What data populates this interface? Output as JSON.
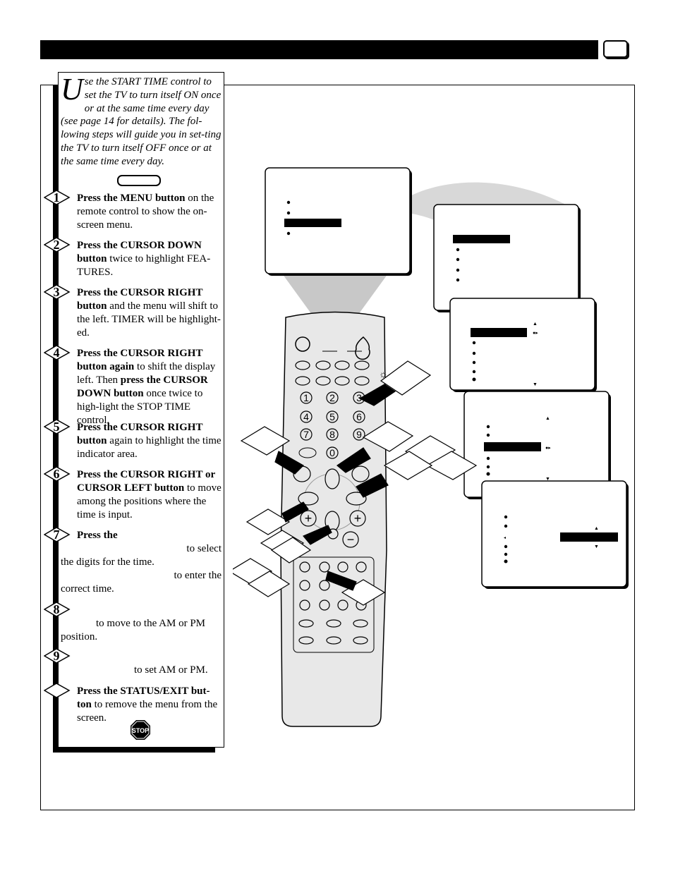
{
  "header": {
    "page_number": ""
  },
  "intro": {
    "dropcap": "U",
    "text": "se the START TIME control to set the TV to turn itself ON once or at the same time every day (see page 14  for details).  The fol-lowing steps will guide you in set-ting the TV to turn itself OFF once or at the same time every day."
  },
  "steps": [
    {
      "num": "1",
      "bold": "Press the MENU button",
      "text": " on the remote control to show the on-screen menu."
    },
    {
      "num": "2",
      "bold": "Press the CURSOR DOWN button",
      "text": " twice to highlight FEA-TURES."
    },
    {
      "num": "3",
      "bold": "Press the CURSOR RIGHT button",
      "text": " and the menu will shift to the left. TIMER will be highlight-ed."
    },
    {
      "num": "4",
      "bold": "Press the CURSOR RIGHT button again",
      "text": " to shift the display left. Then ",
      "bold2": "press the CURSOR DOWN button",
      "text2": " once twice to high-light the STOP TIME control."
    },
    {
      "num": "5",
      "bold": "Press the CURSOR RIGHT button",
      "text": " again to highlight the time indicator area."
    },
    {
      "num": "6",
      "bold": "Press the CURSOR RIGHT or CURSOR LEFT button",
      "text": " to move among the positions where the time is input."
    },
    {
      "num": "7",
      "bold": "Press the",
      "line2": "to select",
      "line3": "the digits for the time.",
      "line4": "to enter the",
      "line5": "correct time."
    },
    {
      "num": "8",
      "line2": "to move to the AM or PM",
      "line3": "position."
    },
    {
      "num": "9",
      "line2": "to set AM or PM."
    },
    {
      "num": "",
      "bold": "Press the STATUS/EXIT but-ton",
      "text": " to remove the menu from the screen."
    }
  ],
  "stop_sign": {
    "label": "STOP",
    "icon": "stop-sign-icon"
  },
  "remote": {
    "digits": [
      "1",
      "2",
      "3",
      "4",
      "5",
      "6",
      "7",
      "8",
      "9",
      "0"
    ],
    "plus": "+",
    "minus": "−"
  }
}
